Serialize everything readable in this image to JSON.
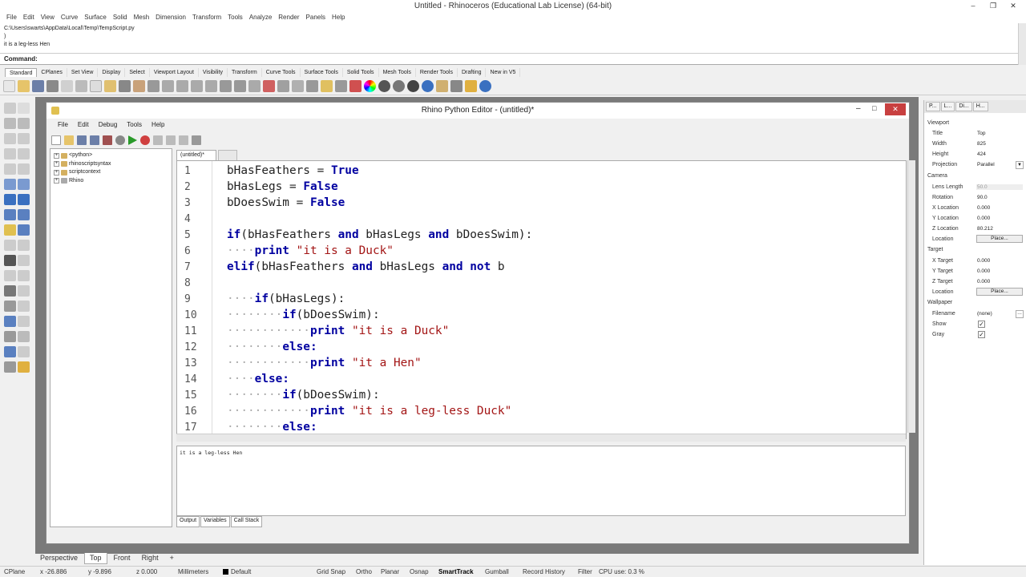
{
  "app": {
    "title": "Untitled - Rhinoceros (Educational Lab License) (64-bit)",
    "menu": [
      "File",
      "Edit",
      "View",
      "Curve",
      "Surface",
      "Solid",
      "Mesh",
      "Dimension",
      "Transform",
      "Tools",
      "Analyze",
      "Render",
      "Panels",
      "Help"
    ]
  },
  "history": {
    "lines": [
      "C:\\Users\\swarts\\AppData\\Local\\Temp\\TempScript.py",
      ")",
      "it is a leg-less Hen"
    ]
  },
  "command": {
    "label": "Command:"
  },
  "toolbar_tabs": [
    "Standard",
    "CPlanes",
    "Set View",
    "Display",
    "Select",
    "Viewport Layout",
    "Visibility",
    "Transform",
    "Curve Tools",
    "Surface Tools",
    "Solid Tools",
    "Mesh Tools",
    "Render Tools",
    "Drafting",
    "New in V5"
  ],
  "editor": {
    "title": "Rhino Python Editor - (untitled)*",
    "menu": [
      "File",
      "Edit",
      "Debug",
      "Tools",
      "Help"
    ],
    "tree": [
      "<python>",
      "rhinoscriptsyntax",
      "scriptcontext",
      "Rhino"
    ],
    "tab_label": "(untitled)*",
    "line_numbers": [
      "1",
      "2",
      "3",
      "4",
      "5",
      "6",
      "7",
      "8",
      "9",
      "10",
      "11",
      "12",
      "13",
      "14",
      "15",
      "16",
      "17"
    ],
    "output_text": "it is a leg-less Hen",
    "output_tabs": [
      "Output",
      "Variables",
      "Call Stack"
    ]
  },
  "viewport_tabs": [
    "Perspective",
    "Top",
    "Front",
    "Right",
    "+"
  ],
  "properties": {
    "tabs": [
      "P...",
      "L...",
      "Di...",
      "H..."
    ],
    "viewport_header": "Viewport",
    "title_label": "Title",
    "title_value": "Top",
    "width_label": "Width",
    "width_value": "825",
    "height_label": "Height",
    "height_value": "424",
    "projection_label": "Projection",
    "projection_value": "Parallel",
    "camera_header": "Camera",
    "lens_label": "Lens Length",
    "lens_value": "50.0",
    "rotation_label": "Rotation",
    "rotation_value": "90.0",
    "xloc_label": "X Location",
    "xloc_value": "0.000",
    "yloc_label": "Y Location",
    "yloc_value": "0.000",
    "zloc_label": "Z Location",
    "zloc_value": "80.212",
    "location_label": "Location",
    "place_label": "Place...",
    "target_header": "Target",
    "xt_label": "X Target",
    "xt_value": "0.000",
    "yt_label": "Y Target",
    "yt_value": "0.000",
    "zt_label": "Z Target",
    "zt_value": "0.000",
    "tloc_label": "Location",
    "tplace_label": "Place...",
    "wallpaper_header": "Wallpaper",
    "filename_label": "Filename",
    "filename_value": "(none)",
    "show_label": "Show",
    "gray_label": "Gray"
  },
  "status": {
    "cplane": "CPlane",
    "x": "x -26.886",
    "y": "y -9.896",
    "z": "z 0.000",
    "units": "Millimeters",
    "layer": "Default",
    "buttons": [
      "Grid Snap",
      "Ortho",
      "Planar",
      "Osnap",
      "SmartTrack",
      "Gumball",
      "Record History",
      "Filter"
    ],
    "cpu": "CPU use: 0.3 %"
  }
}
